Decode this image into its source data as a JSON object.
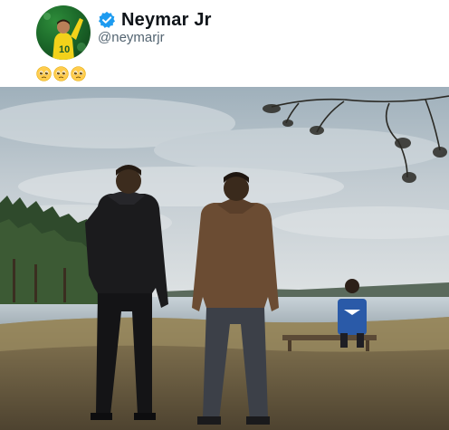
{
  "post": {
    "author": {
      "display_name": "Neymar Jr",
      "handle": "@neymarjr",
      "verified": true
    },
    "text_emojis": [
      "pleading-face-emoji",
      "pleading-face-emoji",
      "pleading-face-emoji"
    ],
    "media": {
      "type": "image",
      "content_icons": [
        "tree-branch",
        "person-back",
        "person-back",
        "child-on-bench",
        "lake",
        "forest"
      ]
    }
  },
  "colors": {
    "verified_badge": "#1d9bf0",
    "handle_text": "#536471",
    "name_text": "#0f1419"
  }
}
